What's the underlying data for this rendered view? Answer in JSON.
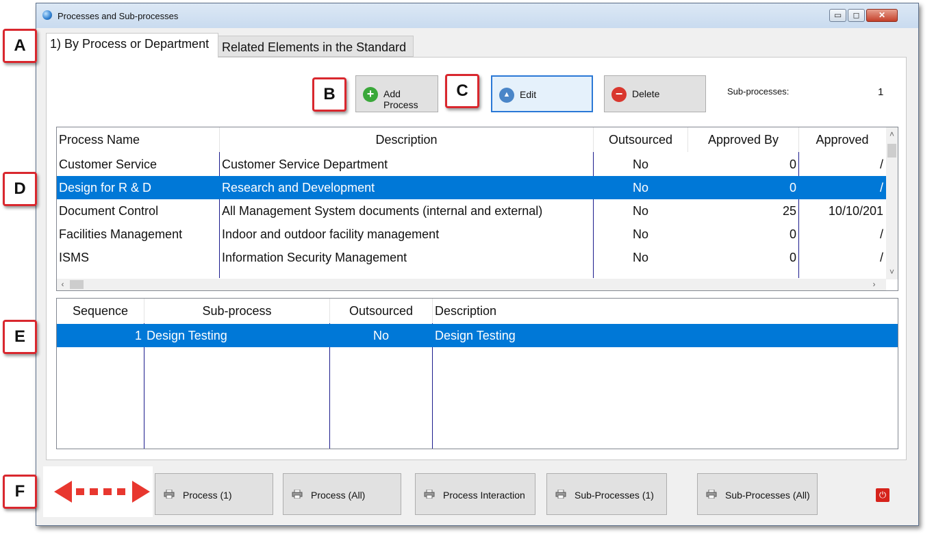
{
  "window": {
    "title": "Processes and Sub-processes",
    "minimize_glyph": "▭",
    "maximize_glyph": "◻",
    "close_glyph": "✕"
  },
  "tabs": [
    {
      "label": "1) By Process or Department",
      "active": true
    },
    {
      "label": "Related Elements in the Standard",
      "active": false
    }
  ],
  "toolbar": {
    "add_label": "Add Process",
    "edit_label": "Edit",
    "delete_label": "Delete",
    "add_icon": "plus-circle-icon",
    "edit_icon": "triangle-circle-icon",
    "delete_icon": "minus-circle-icon",
    "subprocesses_label": "Sub-processes:",
    "subprocesses_count": "1"
  },
  "process_table": {
    "headers": [
      "Process Name",
      "Description",
      "Outsourced",
      "Approved By",
      "Approved"
    ],
    "rows": [
      {
        "name": "Customer Service",
        "description": "Customer Service Department",
        "outsourced": "No",
        "approved_by": "0",
        "approved": "/",
        "selected": false
      },
      {
        "name": "Design for R & D",
        "description": "Research and Development",
        "outsourced": "No",
        "approved_by": "0",
        "approved": "/",
        "selected": true
      },
      {
        "name": "Document Control",
        "description": "All Management System documents (internal and external)",
        "outsourced": "No",
        "approved_by": "25",
        "approved": "10/10/201",
        "selected": false
      },
      {
        "name": "Facilities Management",
        "description": "Indoor and outdoor facility management",
        "outsourced": "No",
        "approved_by": "0",
        "approved": "/",
        "selected": false
      },
      {
        "name": "ISMS",
        "description": "Information Security Management",
        "outsourced": "No",
        "approved_by": "0",
        "approved": "/",
        "selected": false
      }
    ]
  },
  "subprocess_table": {
    "headers": [
      "Sequence",
      "Sub-process",
      "Outsourced",
      "Description"
    ],
    "rows": [
      {
        "sequence": "1",
        "subprocess": "Design Testing",
        "outsourced": "No",
        "description": "Design Testing",
        "selected": true
      }
    ]
  },
  "report_buttons": [
    {
      "label": "Process (1)"
    },
    {
      "label": "Process (All)"
    },
    {
      "label": "Process Interaction"
    },
    {
      "label": "Sub-Processes (1)"
    },
    {
      "label": "Sub-Processes (All)"
    }
  ],
  "callouts": [
    "A",
    "B",
    "C",
    "D",
    "E",
    "F"
  ],
  "colors": {
    "selection": "#0078d7",
    "callout_border": "#d9272e",
    "arrow": "#e8372f",
    "focus_border": "#2a78d6"
  },
  "icons": {
    "app": "globe-icon",
    "printer": "printer-icon",
    "power": "power-icon"
  }
}
